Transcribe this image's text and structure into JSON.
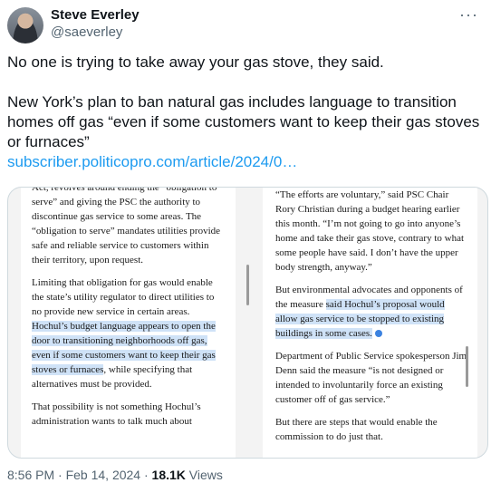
{
  "author": {
    "name": "Steve Everley",
    "handle": "@saeverley"
  },
  "tweet": {
    "line1": "No one is trying to take away your gas stove, they said.",
    "line2": "New York’s plan to ban natural gas includes language to transition homes off gas “even if some customers want to keep their gas stoves or furnaces”",
    "link": "subscriber.politicopro.com/article/2024/0…"
  },
  "media": {
    "left": {
      "p1": "Act, revolves around ending the “obligation to serve” and giving the PSC the authority to discontinue gas service to some areas. The “obligation to serve” mandates utilities provide safe and reliable service to customers within their territory, upon request.",
      "p2_pre": "Limiting that obligation for gas would enable the state’s utility regulator to direct utilities to no provide new service in certain areas. ",
      "p2_hl": "Hochul’s budget language appears to open the door to transitioning neighborhoods off gas, even if some customers want to keep their gas stoves or furnaces",
      "p2_post": ", while specifying that alternatives must be provided.",
      "p3": "That possibility is not something Hochul’s administration wants to talk much about"
    },
    "right": {
      "p1": "“The efforts are voluntary,” said PSC Chair Rory Christian during a budget hearing earlier this month. “I’m not going to go into anyone’s home and take their gas stove, contrary to what some people have said. I don’t have the upper body strength, anyway.”",
      "p2_pre": "But environmental advocates and opponents of the measure ",
      "p2_hl": "said Hochul’s proposal would allow gas service to be stopped to existing buildings in some cases.",
      "p3": "Department of Public Service spokesperson Jim Denn said the measure “is not designed or intended to involuntarily force an existing customer off of gas service.”",
      "p4": "But there are steps that would enable the commission to do just that."
    }
  },
  "meta": {
    "timestamp": "8:56 PM · Feb 14, 2024 · ",
    "views_count": "18.1K",
    "views_label": " Views"
  },
  "colors": {
    "link": "#1d9bf0",
    "muted": "#536471",
    "highlight": "#cfe2f7"
  }
}
